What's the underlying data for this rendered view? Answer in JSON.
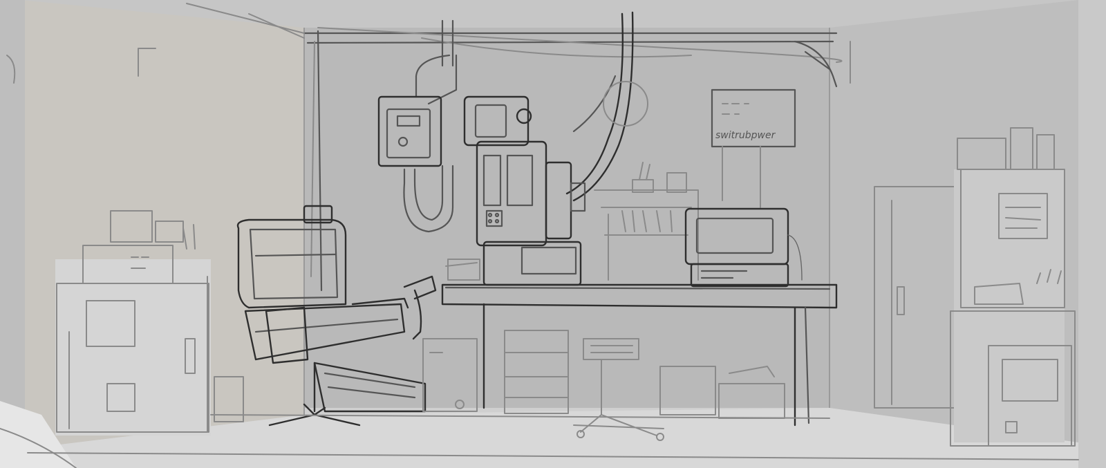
{
  "scene": {
    "kind": "pencil-sketch-interior",
    "palette": {
      "back_wall": "#b9b9b9",
      "left_wall": "#c8c5bf",
      "right_wall": "#bdbdbd",
      "floor": "#d6d6d6",
      "ceiling": "#c4c4c4",
      "ink": "#555555",
      "ink_dark": "#2e2e2e"
    }
  },
  "whiteboard": {
    "scribble": "switrubpwer"
  }
}
